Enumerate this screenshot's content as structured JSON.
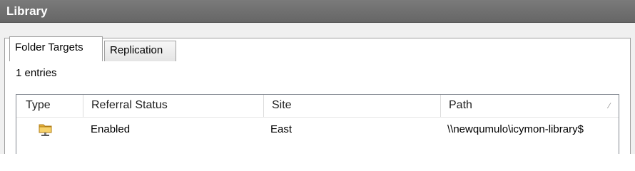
{
  "window": {
    "title": "Library"
  },
  "tabs": [
    {
      "label": "Folder Targets",
      "active": true
    },
    {
      "label": "Replication",
      "active": false
    }
  ],
  "list": {
    "count_text": "1 entries",
    "columns": [
      "Type",
      "Referral Status",
      "Site",
      "Path"
    ],
    "sort_indicator": "∕",
    "rows": [
      {
        "type_icon": "folder-share-icon",
        "referral_status": "Enabled",
        "site": "East",
        "path": "\\\\newqumulo\\icymon-library$"
      }
    ]
  },
  "colors": {
    "titlebar": "#6e6e6e",
    "panel_background": "#f0f0f0",
    "folder_icon": "#e8b23a"
  }
}
